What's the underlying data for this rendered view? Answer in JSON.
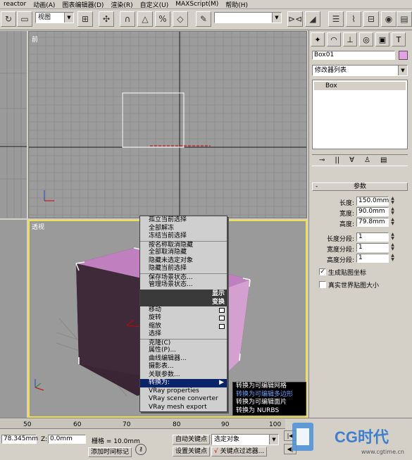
{
  "menu": [
    "reactor",
    "动画(A)",
    "图表编辑器(D)",
    "渲染(R)",
    "自定义(U)",
    "MAXScript(M)",
    "帮助(H)"
  ],
  "toolbar": {
    "view_combo": "视图",
    "sel_combo": ""
  },
  "viewports": {
    "top_label": "前",
    "persp_label": "透视"
  },
  "panel": {
    "object_name": "Box01",
    "modifier_list": "修改器列表",
    "stack_item": "Box",
    "rollout_title": "参数",
    "params": [
      {
        "label": "长度:",
        "value": "150.0mm"
      },
      {
        "label": "宽度:",
        "value": "90.0mm"
      },
      {
        "label": "高度:",
        "value": "79.8mm"
      },
      {
        "label": "长度分段:",
        "value": "1"
      },
      {
        "label": "宽度分段:",
        "value": "1"
      },
      {
        "label": "高度分段:",
        "value": "1"
      }
    ],
    "check_gen": "生成贴图坐标",
    "check_real": "真实世界贴图大小",
    "colors": {
      "swatch": "#e6a0e6"
    }
  },
  "quad": {
    "display_items": [
      "孤立当前选择",
      "全部解冻",
      "冻结当前选择",
      "按名称取消隐藏",
      "全部取消隐藏",
      "隐藏未选定对象",
      "隐藏当前选择",
      "保存场景状态...",
      "管理场景状态..."
    ],
    "display_head": "显示",
    "transform_head": "变换",
    "transform_items": [
      "移动",
      "旋转",
      "缩放",
      "选择",
      "克隆(C)",
      "属性(P)...",
      "曲线编辑器...",
      "摄影表...",
      "关联参数...",
      "转换为:",
      "VRay properties",
      "VRay scene converter",
      "VRay mesh export"
    ],
    "convert_sub": [
      "转换为可编辑网格",
      "转换为可编辑多边形",
      "转换为可编辑面片",
      "转换为 NURBS"
    ]
  },
  "timeline": {
    "ticks": [
      "50",
      "60",
      "70",
      "80",
      "90",
      "100"
    ]
  },
  "status": {
    "x_val": "78.345mm",
    "z_label": "Z:",
    "z_val": "0.0mm",
    "grid": "栅格 = 10.0mm",
    "auto_key": "自动关键点",
    "set_key": "设置关键点",
    "sel_obj": "选定对象",
    "key_filter": "关键点过滤器...",
    "add_time": "添加时间标记"
  },
  "watermark": {
    "brand": "CG时代",
    "url": "www.cgtime.cn"
  }
}
